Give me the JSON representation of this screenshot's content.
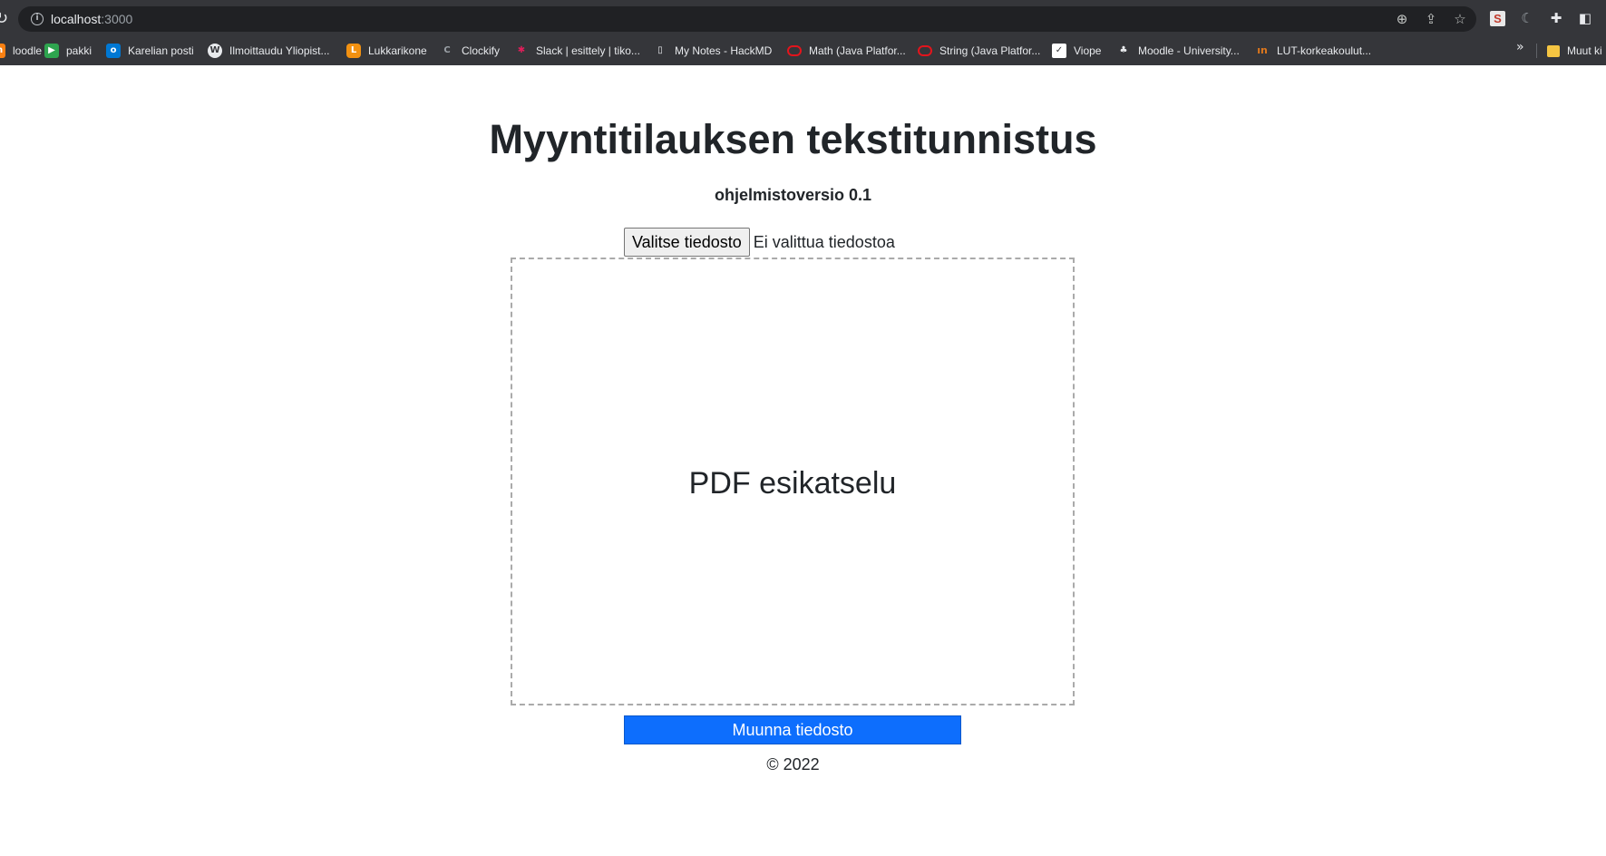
{
  "browser": {
    "url_host": "localhost",
    "url_port": ":3000",
    "toolbar_icons": [
      "reload-icon",
      "info-icon",
      "zoom-icon",
      "share-icon",
      "star-icon",
      "extension-s-icon",
      "extension-c-icon",
      "puzzle-icon",
      "sidepanel-icon"
    ],
    "bookmarks": [
      {
        "label": "loodle",
        "icon": "moodle-favicon",
        "color": "#f98012"
      },
      {
        "label": "pakki",
        "icon": "pakki-favicon",
        "color": "#2ea44f"
      },
      {
        "label": "Karelian posti",
        "icon": "outlook-favicon",
        "color": "#0078d4"
      },
      {
        "label": "Ilmoittaudu Yliopist...",
        "icon": "wordpress-favicon",
        "color": "#e8eaed"
      },
      {
        "label": "Lukkarikone",
        "icon": "lukkarikone-favicon",
        "color": "#f29111"
      },
      {
        "label": "Clockify",
        "icon": "clockify-favicon",
        "color": "#9aa0a6"
      },
      {
        "label": "Slack | esittely | tiko...",
        "icon": "slack-favicon",
        "color": "#e01e5a"
      },
      {
        "label": "My Notes - HackMD",
        "icon": "document-favicon",
        "color": "#e8eaed"
      },
      {
        "label": "Math (Java Platfor...",
        "icon": "oracle-favicon",
        "color": "#e3141c"
      },
      {
        "label": "String (Java Platfor...",
        "icon": "oracle-favicon",
        "color": "#e3141c"
      },
      {
        "label": "Viope",
        "icon": "viope-favicon",
        "color": "#ffffff"
      },
      {
        "label": "Moodle - University...",
        "icon": "moodle-hat-favicon",
        "color": "#e8eaed"
      },
      {
        "label": "LUT-korkeakoulut...",
        "icon": "lut-favicon",
        "color": "#e0781c"
      }
    ],
    "more_bookmarks_glyph": "»",
    "other_bookmarks_label": "Muut ki"
  },
  "page": {
    "title": "Myyntitilauksen tekstitunnistus",
    "version": "ohjelmistoversio 0.1",
    "choose_file_label": "Valitse tiedosto",
    "no_file_text": "Ei valittua tiedostoa",
    "preview_label": "PDF esikatselu",
    "convert_label": "Muunna tiedosto",
    "footer": "© 2022"
  },
  "colors": {
    "primary_button": "#0d6efd",
    "chrome_bg": "#35363a",
    "omnibox_bg": "#202124",
    "text": "#212529"
  }
}
